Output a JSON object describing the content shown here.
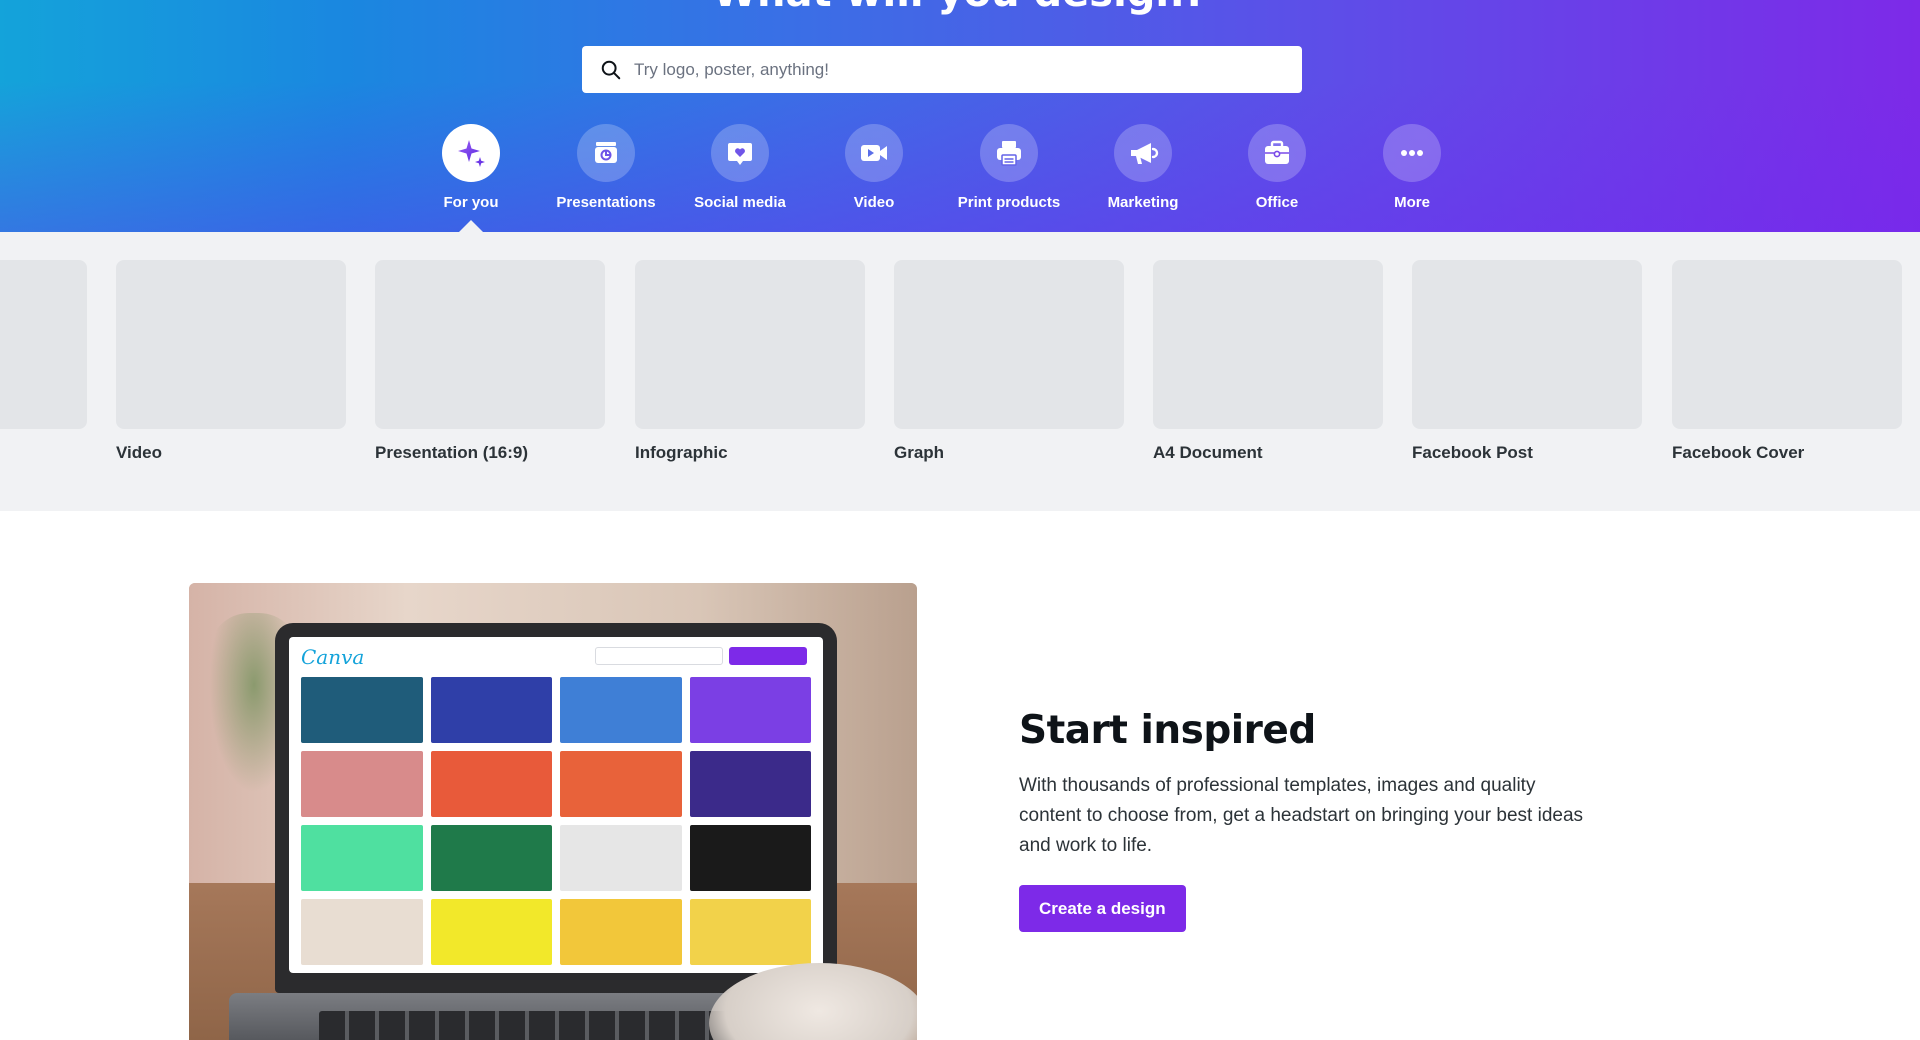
{
  "hero": {
    "title": "What will you design?",
    "search_placeholder": "Try logo, poster, anything!",
    "gradient_start": "#14a3da",
    "gradient_end": "#7d2ae8"
  },
  "categories": [
    {
      "label": "For you",
      "icon": "sparkle-icon",
      "active": true
    },
    {
      "label": "Presentations",
      "icon": "presentation-icon",
      "active": false
    },
    {
      "label": "Social media",
      "icon": "heart-chat-icon",
      "active": false
    },
    {
      "label": "Video",
      "icon": "video-camera-icon",
      "active": false
    },
    {
      "label": "Print products",
      "icon": "printer-icon",
      "active": false
    },
    {
      "label": "Marketing",
      "icon": "megaphone-icon",
      "active": false
    },
    {
      "label": "Office",
      "icon": "briefcase-icon",
      "active": false
    },
    {
      "label": "More",
      "icon": "more-dots-icon",
      "active": false
    }
  ],
  "templates": [
    {
      "label": ""
    },
    {
      "label": "Video"
    },
    {
      "label": "Presentation (16:9)"
    },
    {
      "label": "Infographic"
    },
    {
      "label": "Graph"
    },
    {
      "label": "A4 Document"
    },
    {
      "label": "Facebook Post"
    },
    {
      "label": "Facebook Cover"
    }
  ],
  "promo": {
    "title": "Start inspired",
    "body": "With thousands of professional templates, images and quality content to choose from, get a headstart on bringing your best ideas and work to life.",
    "cta": "Create a design",
    "screen_logo": "Canva",
    "accent": "#7d2ae8"
  }
}
